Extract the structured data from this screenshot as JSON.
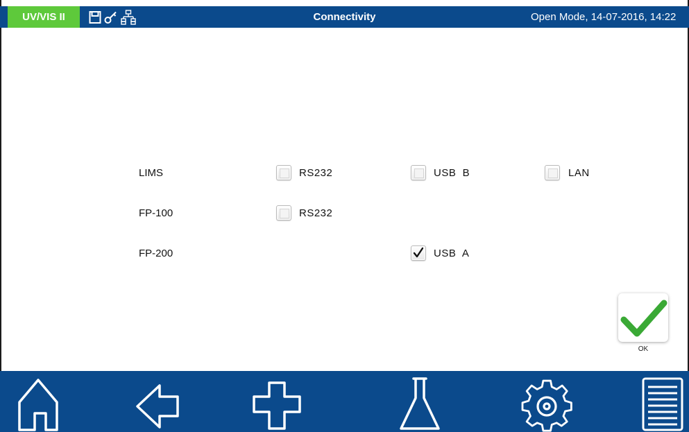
{
  "header": {
    "app_badge": "UV/VIS II",
    "title": "Connectivity",
    "status": "Open Mode, 14-07-2016, 14:22",
    "icons": [
      "save-icon",
      "key-icon",
      "network-icon"
    ]
  },
  "rows": [
    {
      "label": "LIMS",
      "options": [
        {
          "label": "RS232",
          "checked": false
        },
        {
          "label": "USB  B",
          "checked": false
        },
        {
          "label": "LAN",
          "checked": false
        }
      ]
    },
    {
      "label": "FP-100",
      "options": [
        {
          "label": "RS232",
          "checked": false
        }
      ]
    },
    {
      "label": "FP-200",
      "options": [
        {
          "label": "USB  A",
          "checked": true
        }
      ]
    }
  ],
  "ok_button": {
    "label": "OK"
  },
  "nav": [
    "home-icon",
    "back-arrow-icon",
    "add-icon",
    "flask-icon",
    "settings-gear-icon",
    "menu-list-icon"
  ],
  "colors": {
    "bar": "#0b4a8c",
    "badge": "#5ec93b",
    "ok_check": "#3aa935"
  }
}
